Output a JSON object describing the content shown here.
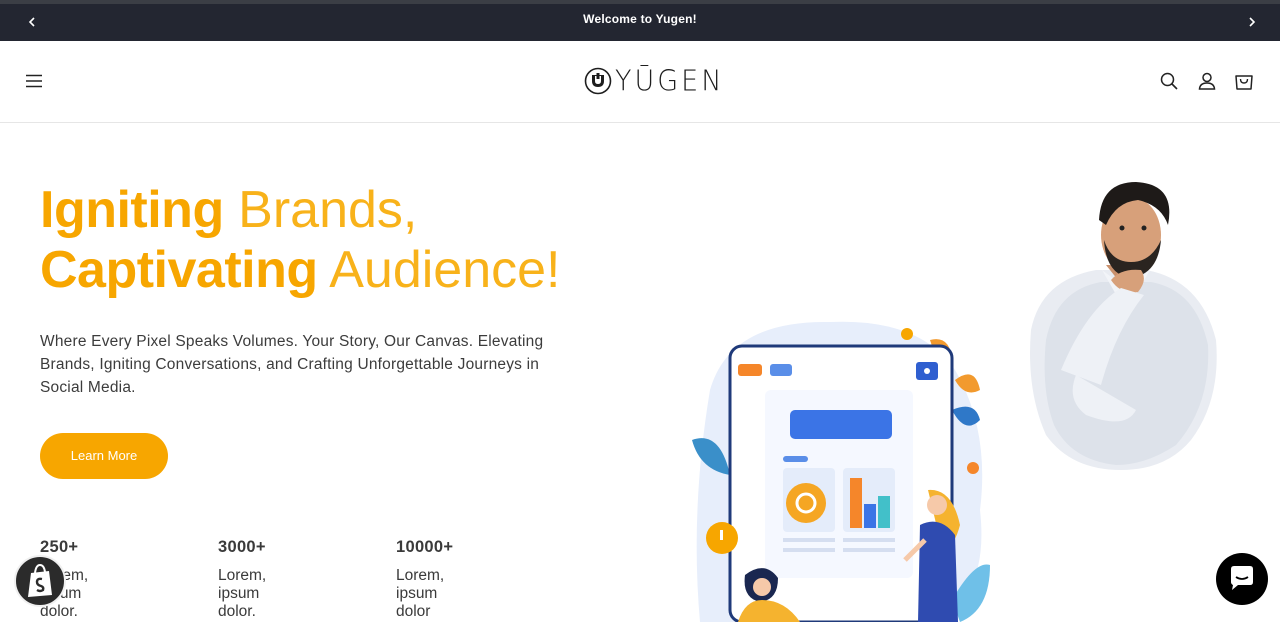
{
  "announcement": {
    "text": "Welcome to Yugen!",
    "prev_icon": "chevron-left-icon",
    "next_icon": "chevron-right-icon"
  },
  "header": {
    "logo_text": "YŪGEN",
    "menu_icon": "hamburger-menu-icon",
    "search_icon": "search-icon",
    "account_icon": "account-icon",
    "cart_icon": "cart-icon"
  },
  "hero": {
    "headline_line1_bold": "Igniting",
    "headline_line1_light": " Brands,",
    "headline_line2_bold": "Captivating",
    "headline_line2_light": " Audience!",
    "subtext": "Where Every Pixel Speaks Volumes. Your Story, Our Canvas. Elevating Brands, Igniting Conversations, and Crafting Unforgettable Journeys in Social Media.",
    "cta_label": "Learn More"
  },
  "stats": [
    {
      "number": "250+",
      "desc": "Lorem, ipsum dolor."
    },
    {
      "number": "3000+",
      "desc": "Lorem, ipsum dolor."
    },
    {
      "number": "10000+",
      "desc": "Lorem, ipsum dolor"
    }
  ],
  "colors": {
    "accent": "#f7a600",
    "announcement_bg": "#232631",
    "text": "#3c3c3c"
  }
}
